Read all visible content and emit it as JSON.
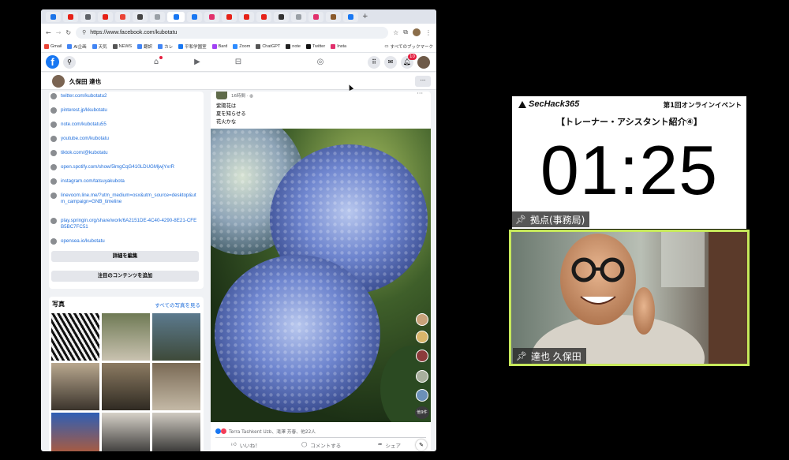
{
  "browser": {
    "url": "https://www.facebook.com/kubotatu",
    "bookmarks": [
      "Gmail",
      "AI企画",
      "天気",
      "NEWS",
      "翻訳",
      "カレ",
      "平和学園室",
      "Bard",
      "Zoom",
      "ChatGPT",
      "note",
      "Twitter",
      "Insta"
    ],
    "bookmarks_all": "すべてのブックマーク"
  },
  "facebook": {
    "logo": "f",
    "notification_count": "10",
    "profile_name": "久保田 達也",
    "more_label": "···",
    "links": [
      "twitter.com/kubotatu2",
      "pinterest.jp/kkubotatu",
      "note.com/kubotatu55",
      "youtube.com/kubotatu",
      "tiktok.com/@kubotatu",
      "open.spotify.com/show/5lmgCqG410LDUGMjwjYxrR",
      "instagram.com/tatsuyakubota",
      "linevoom.line.me/?utm_medium=osx&utm_source=desktop&utm_campaign=GNB_timeline",
      "play.springin.org/share/work/6A2151DE-4C40-4290-8E21-CFEB5BC7FC51",
      "opensea.io/kubotatu"
    ],
    "edit_details": "詳細を編集",
    "add_featured": "注目のコンテンツを追加",
    "photos_title": "写真",
    "see_all_photos": "すべての写真を見る",
    "post": {
      "time": "16時間 · ◍",
      "text_lines": [
        "紫陽花は",
        "夏を知らせる",
        "花火かな"
      ],
      "reactions": "Terra Tashkent Uzb、滝澤 芳春、他22人",
      "like": "いいね！",
      "comment": "コメントする",
      "share": "シェア",
      "more_badge": "他9件"
    }
  },
  "event": {
    "brand": "SecHack365",
    "event_name": "第1回オンラインイベント",
    "session": "【トレーナー・アシスタント紹介④】",
    "timer": "01:25",
    "location_tag": "拠点(事務局)",
    "speaker_tag": "達也 久保田"
  },
  "colors": {
    "fb_blue": "#1877f2",
    "link_blue": "#216fdb",
    "video_border": "#c7e95b"
  }
}
